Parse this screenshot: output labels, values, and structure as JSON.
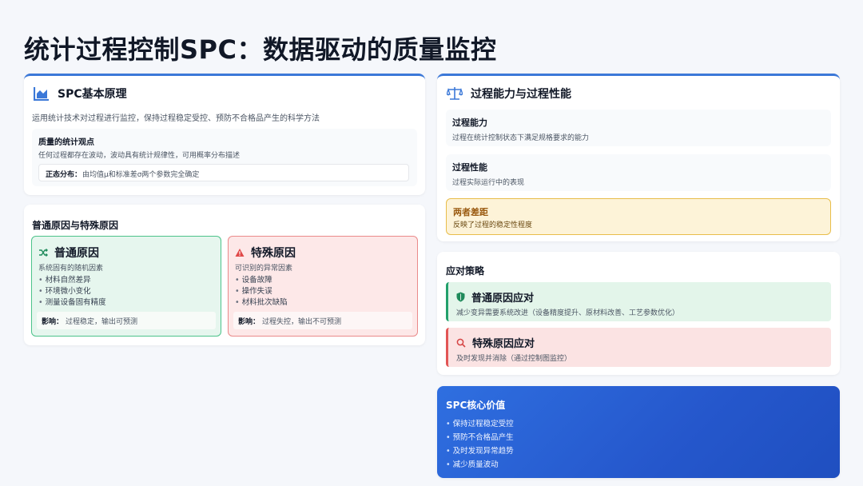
{
  "title": "统计过程控制SPC：数据驱动的质量监控",
  "colors": {
    "accent": "#3b78d8",
    "green": "#22a06b",
    "red": "#e25555",
    "yellow": "#e0b43c",
    "blue_gradient_start": "#2f6fe0",
    "blue_gradient_end": "#1f4fc0"
  },
  "basics": {
    "icon": "area-chart-icon",
    "heading": "SPC基本原理",
    "desc": "运用统计技术对过程进行监控，保持过程稳定受控、预防不合格品产生的科学方法",
    "view_title": "质量的统计观点",
    "view_desc": "任何过程都存在波动，波动具有统计规律性，可用概率分布描述",
    "normal_label": "正态分布：",
    "normal_text": "由均值μ和标准差σ两个参数完全确定"
  },
  "causes": {
    "heading": "普通原因与特殊原因",
    "common": {
      "icon": "shuffle-icon",
      "title": "普通原因",
      "desc": "系统固有的随机因素",
      "items": [
        "材料自然差异",
        "环境微小变化",
        "测量设备固有精度"
      ],
      "impact_label": "影响：",
      "impact_text": "过程稳定，输出可预测"
    },
    "special": {
      "icon": "warning-icon",
      "title": "特殊原因",
      "desc": "可识别的异常因素",
      "items": [
        "设备故障",
        "操作失误",
        "材料批次缺陷"
      ],
      "impact_label": "影响：",
      "impact_text": "过程失控，输出不可预测"
    }
  },
  "capability": {
    "icon": "balance-scale-icon",
    "heading": "过程能力与过程性能",
    "cap_title": "过程能力",
    "cap_desc": "过程在统计控制状态下满足规格要求的能力",
    "perf_title": "过程性能",
    "perf_desc": "过程实际运行中的表现",
    "gap_title": "两者差距",
    "gap_desc": "反映了过程的稳定性程度"
  },
  "strategy": {
    "heading": "应对策略",
    "common_icon": "shield-icon",
    "common_title": "普通原因应对",
    "common_desc": "减少变异需要系统改进（设备精度提升、原材料改善、工艺参数优化）",
    "special_icon": "search-icon",
    "special_title": "特殊原因应对",
    "special_desc": "及时发现并消除（通过控制图监控）"
  },
  "core_value": {
    "heading": "SPC核心价值",
    "items": [
      "保持过程稳定受控",
      "预防不合格品产生",
      "及时发现异常趋势",
      "减少质量波动"
    ]
  }
}
